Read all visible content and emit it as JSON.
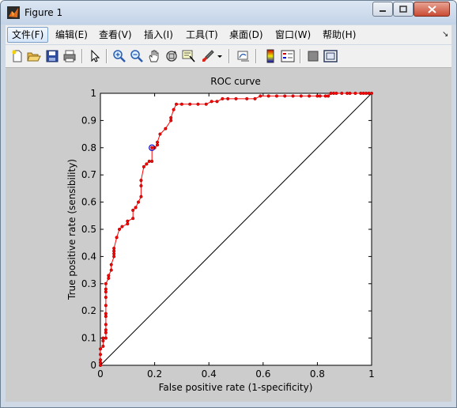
{
  "window": {
    "title": "Figure 1"
  },
  "menu": [
    {
      "label": "文件(F)",
      "active": true
    },
    {
      "label": "编辑(E)"
    },
    {
      "label": "查看(V)"
    },
    {
      "label": "插入(I)"
    },
    {
      "label": "工具(T)"
    },
    {
      "label": "桌面(D)"
    },
    {
      "label": "窗口(W)"
    },
    {
      "label": "帮助(H)"
    }
  ],
  "toolbar": {
    "icons": [
      "new-figure-icon",
      "open-file-icon",
      "save-icon",
      "print-icon",
      "edit-plot-arrow-icon",
      "zoom-in-icon",
      "zoom-out-icon",
      "pan-hand-icon",
      "rotate-3d-icon",
      "data-cursor-icon",
      "brush-icon",
      "brush-dropdown-icon",
      "link-plot-icon",
      "colorbar-icon",
      "legend-icon",
      "hide-plot-tools-icon",
      "show-plot-tools-icon"
    ]
  },
  "chart_data": {
    "type": "line",
    "title": "ROC curve",
    "xlabel": "False positive rate (1-specificity)",
    "ylabel": "True positive rate (sensibility)",
    "xlim": [
      0,
      1
    ],
    "ylim": [
      0,
      1
    ],
    "xticks": [
      "0",
      "0.2",
      "0.4",
      "0.6",
      "0.8",
      "1"
    ],
    "yticks": [
      "0",
      "0.1",
      "0.2",
      "0.3",
      "0.4",
      "0.5",
      "0.6",
      "0.7",
      "0.8",
      "0.9",
      "1"
    ],
    "grid": false,
    "colors": {
      "roc": "#ff0000",
      "diagonal": "#000000",
      "marker_edge": "#880000",
      "optimal": "#0000cc"
    },
    "series": [
      {
        "x": [
          0,
          0,
          0,
          0,
          0,
          0.01,
          0.01,
          0.01,
          0.02,
          0.02,
          0.02,
          0.02,
          0.02,
          0.02,
          0.02,
          0.02,
          0.02,
          0.02,
          0.02,
          0.03,
          0.03,
          0.04,
          0.04,
          0.05,
          0.05,
          0.05,
          0.05,
          0.06,
          0.07,
          0.08,
          0.1,
          0.1,
          0.12,
          0.12,
          0.13,
          0.14,
          0.15,
          0.15,
          0.15,
          0.16,
          0.17,
          0.18,
          0.19,
          0.19,
          0.2,
          0.21,
          0.21,
          0.22,
          0.24,
          0.26,
          0.26,
          0.27,
          0.28,
          0.3,
          0.33,
          0.36,
          0.39,
          0.41,
          0.43,
          0.45,
          0.47,
          0.5,
          0.54,
          0.57,
          0.59,
          0.62,
          0.65,
          0.68,
          0.71,
          0.74,
          0.77,
          0.8,
          0.81,
          0.83,
          0.84,
          0.85,
          0.86,
          0.87,
          0.89,
          0.91,
          0.92,
          0.94,
          0.96,
          0.97,
          0.98,
          0.99,
          1.0
        ],
        "y": [
          0,
          0.01,
          0.02,
          0.04,
          0.06,
          0.07,
          0.09,
          0.1,
          0.1,
          0.12,
          0.13,
          0.15,
          0.18,
          0.19,
          0.22,
          0.25,
          0.27,
          0.28,
          0.3,
          0.32,
          0.33,
          0.35,
          0.37,
          0.4,
          0.41,
          0.42,
          0.43,
          0.47,
          0.5,
          0.51,
          0.52,
          0.53,
          0.54,
          0.57,
          0.58,
          0.6,
          0.62,
          0.66,
          0.68,
          0.73,
          0.74,
          0.75,
          0.75,
          0.8,
          0.8,
          0.81,
          0.82,
          0.85,
          0.87,
          0.9,
          0.91,
          0.94,
          0.96,
          0.96,
          0.96,
          0.96,
          0.96,
          0.97,
          0.97,
          0.98,
          0.98,
          0.98,
          0.98,
          0.98,
          0.99,
          0.99,
          0.99,
          0.99,
          0.99,
          0.99,
          0.99,
          0.99,
          0.99,
          0.99,
          0.99,
          1.0,
          1.0,
          1.0,
          1.0,
          1.0,
          1.0,
          1.0,
          1.0,
          1.0,
          1.0,
          1.0,
          1.0
        ]
      }
    ],
    "optimal_point": {
      "x": 0.19,
      "y": 0.8
    }
  }
}
